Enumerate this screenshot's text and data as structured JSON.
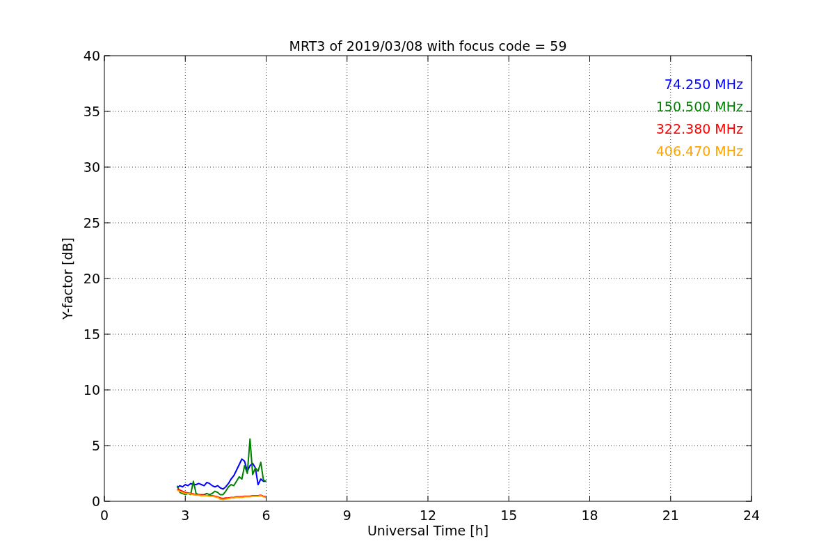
{
  "chart_data": {
    "type": "line",
    "title": "MRT3 of 2019/03/08 with focus code = 59",
    "xlabel": "Universal Time [h]",
    "ylabel": "Y-factor [dB]",
    "x": [
      2.7,
      2.8,
      2.9,
      3.0,
      3.1,
      3.2,
      3.3,
      3.4,
      3.5,
      3.6,
      3.7,
      3.8,
      3.9,
      4.0,
      4.1,
      4.2,
      4.3,
      4.4,
      4.5,
      4.6,
      4.7,
      4.8,
      4.9,
      5.0,
      5.1,
      5.2,
      5.3,
      5.4,
      5.5,
      5.6,
      5.7,
      5.8,
      5.9,
      6.0
    ],
    "series": [
      {
        "name": "74.250 MHz",
        "color": "#0000ff",
        "values": [
          1.2,
          1.4,
          1.3,
          1.5,
          1.4,
          1.6,
          1.5,
          1.5,
          1.6,
          1.5,
          1.4,
          1.7,
          1.6,
          1.4,
          1.3,
          1.4,
          1.2,
          1.1,
          1.3,
          1.6,
          2.0,
          2.3,
          2.8,
          3.3,
          3.8,
          3.6,
          2.7,
          3.2,
          3.4,
          3.0,
          1.5,
          2.0,
          1.8,
          1.8
        ]
      },
      {
        "name": "150.500 MHz",
        "color": "#008000",
        "values": [
          1.4,
          0.8,
          0.7,
          0.6,
          0.7,
          0.6,
          1.8,
          0.7,
          0.6,
          0.6,
          0.6,
          0.7,
          0.6,
          0.7,
          0.9,
          0.8,
          0.6,
          0.6,
          0.9,
          1.3,
          1.5,
          1.4,
          1.8,
          2.2,
          2.0,
          3.2,
          2.5,
          5.6,
          2.4,
          3.0,
          2.7,
          3.5,
          1.9,
          1.8
        ]
      },
      {
        "name": "322.380 MHz",
        "color": "#ff0000",
        "values": [
          1.1,
          1.0,
          0.9,
          0.8,
          0.75,
          0.7,
          0.65,
          0.6,
          0.6,
          0.55,
          0.55,
          0.5,
          0.5,
          0.5,
          0.45,
          0.4,
          0.3,
          0.25,
          0.3,
          0.3,
          0.35,
          0.35,
          0.4,
          0.4,
          0.4,
          0.45,
          0.45,
          0.45,
          0.5,
          0.5,
          0.5,
          0.55,
          0.45,
          0.4
        ]
      },
      {
        "name": "406.470 MHz",
        "color": "#ffa500",
        "values": [
          1.0,
          0.9,
          0.8,
          0.7,
          0.7,
          0.65,
          0.6,
          0.55,
          0.55,
          0.5,
          0.5,
          0.5,
          0.45,
          0.45,
          0.4,
          0.35,
          0.2,
          0.15,
          0.2,
          0.25,
          0.3,
          0.3,
          0.35,
          0.35,
          0.35,
          0.4,
          0.4,
          0.4,
          0.45,
          0.45,
          0.45,
          0.5,
          0.4,
          0.35
        ]
      }
    ],
    "grid": true,
    "xlim": [
      0,
      24
    ],
    "ylim": [
      0,
      40
    ],
    "xticks": [
      0,
      3,
      6,
      9,
      12,
      15,
      18,
      21,
      24
    ],
    "yticks": [
      0,
      5,
      10,
      15,
      20,
      25,
      30,
      35,
      40
    ]
  }
}
